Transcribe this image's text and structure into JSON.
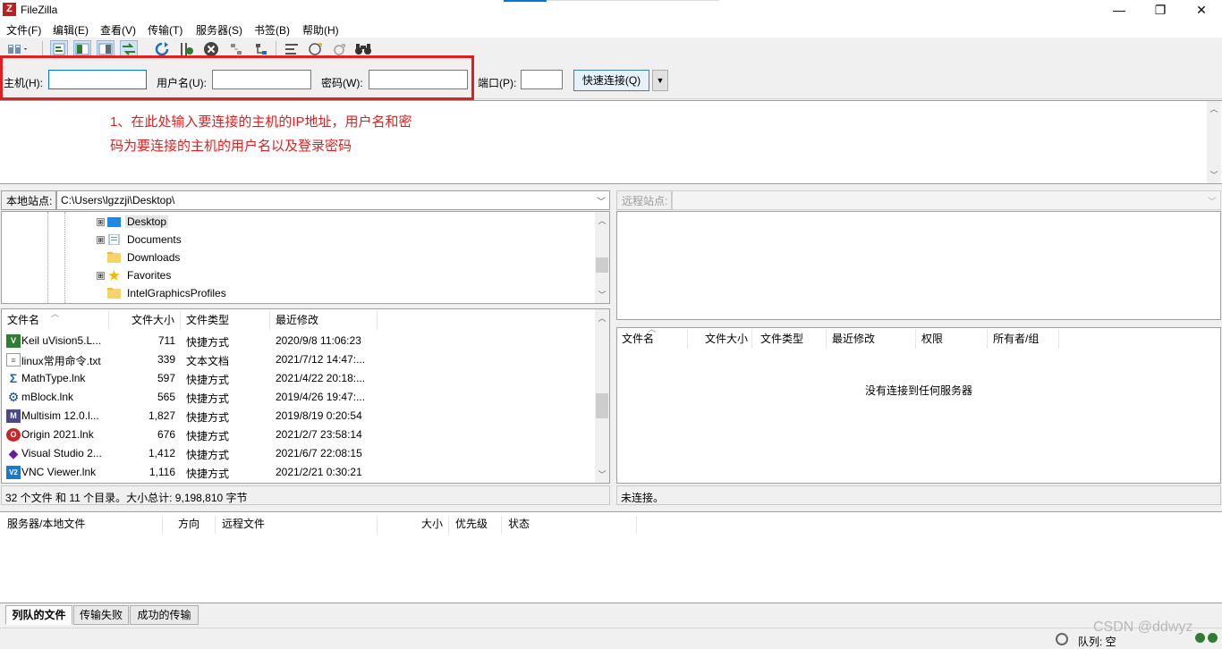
{
  "window": {
    "title": "FileZilla",
    "app_icon": "Z",
    "minimize": "—",
    "maximize": "❐",
    "close": "✕"
  },
  "menu": [
    "文件(F)",
    "编辑(E)",
    "查看(V)",
    "传输(T)",
    "服务器(S)",
    "书签(B)",
    "帮助(H)"
  ],
  "quickconnect": {
    "host_label": "主机(H):",
    "user_label": "用户名(U):",
    "pass_label": "密码(W):",
    "port_label": "端口(P):",
    "host_value": "",
    "user_value": "",
    "pass_value": "",
    "port_value": "",
    "connect_label": "快速连接(Q)",
    "dropdown_arrow": "▼"
  },
  "annotation": {
    "line1": "1、在此处输入要连接的主机的IP地址，用户名和密",
    "line2": "码为要连接的主机的用户名以及登录密码",
    "color": "#e02020"
  },
  "local": {
    "site_label": "本地站点:",
    "path": "C:\\Users\\lgzzji\\Desktop\\",
    "tree": [
      {
        "name": "Desktop",
        "expander": "⊞",
        "selected": true
      },
      {
        "name": "Documents",
        "expander": "⊞",
        "selected": false
      },
      {
        "name": "Downloads",
        "expander": "",
        "selected": false
      },
      {
        "name": "Favorites",
        "expander": "⊞",
        "selected": false
      },
      {
        "name": "IntelGraphicsProfiles",
        "expander": "",
        "selected": false
      }
    ],
    "columns": {
      "name": "文件名",
      "size": "文件大小",
      "type": "文件类型",
      "modified": "最近修改"
    },
    "files": [
      {
        "name": "Keil uVision5.L...",
        "size": "711",
        "type": "快捷方式",
        "modified": "2020/9/8 11:06:23",
        "icon": "V",
        "color": "#2e7d32"
      },
      {
        "name": "linux常用命令.txt",
        "size": "339",
        "type": "文本文档",
        "modified": "2021/7/12 14:47:...",
        "icon": "≡",
        "color": "#8a8a8a"
      },
      {
        "name": "MathType.lnk",
        "size": "597",
        "type": "快捷方式",
        "modified": "2021/4/22 20:18:...",
        "icon": "Σ",
        "color": "#1565c0"
      },
      {
        "name": "mBlock.lnk",
        "size": "565",
        "type": "快捷方式",
        "modified": "2019/4/26 19:47:...",
        "icon": "⚙",
        "color": "#0d47a1"
      },
      {
        "name": "Multisim 12.0.l...",
        "size": "1,827",
        "type": "快捷方式",
        "modified": "2019/8/19 0:20:54",
        "icon": "M",
        "color": "#4a4a8a"
      },
      {
        "name": "Origin 2021.lnk",
        "size": "676",
        "type": "快捷方式",
        "modified": "2021/2/7 23:58:14",
        "icon": "O",
        "color": "#c62828"
      },
      {
        "name": "Visual Studio 2...",
        "size": "1,412",
        "type": "快捷方式",
        "modified": "2021/6/7 22:08:15",
        "icon": "◆",
        "color": "#6a1b9a"
      },
      {
        "name": "VNC Viewer.lnk",
        "size": "1,116",
        "type": "快捷方式",
        "modified": "2021/2/21 0:30:21",
        "icon": "V2",
        "color": "#1976d2"
      }
    ],
    "status": "32 个文件 和 11 个目录。大小总计: 9,198,810 字节"
  },
  "remote": {
    "site_label": "远程站点:",
    "path": "",
    "columns": {
      "name": "文件名",
      "size": "文件大小",
      "type": "文件类型",
      "modified": "最近修改",
      "perm": "权限",
      "owner": "所有者/组"
    },
    "empty_message": "没有连接到任何服务器",
    "status": "未连接。"
  },
  "queue": {
    "columns": {
      "server": "服务器/本地文件",
      "direction": "方向",
      "remote": "远程文件",
      "size": "大小",
      "priority": "优先级",
      "status": "状态"
    },
    "tabs": [
      "列队的文件",
      "传输失败",
      "成功的传输"
    ]
  },
  "statusbar": {
    "queue_text": "队列: 空"
  },
  "watermark": "CSDN @ddwyz"
}
